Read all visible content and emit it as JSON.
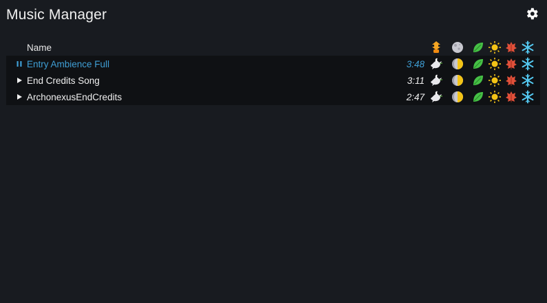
{
  "app": {
    "title": "Music Manager"
  },
  "table": {
    "header": {
      "name_label": "Name"
    },
    "tracks": [
      {
        "name": "Entry Ambience Full",
        "duration": "3:48",
        "state": "playing"
      },
      {
        "name": "End Credits Song",
        "duration": "3:11",
        "state": "stopped"
      },
      {
        "name": "ArchonexusEndCredits",
        "duration": "2:47",
        "state": "stopped"
      }
    ]
  },
  "icons": {
    "settings": "gear-icon",
    "play": "play-icon",
    "pause": "pause-icon",
    "header_condition_1": "danger-fist-icon",
    "header_condition_2": "moon-icon",
    "row_condition_1": "peace-dove-icon",
    "row_condition_2": "day-night-icon",
    "season_spring": "spring-leaf-icon",
    "season_summer": "summer-sun-icon",
    "season_fall": "fall-leaf-icon",
    "season_winter": "winter-snowflake-icon"
  },
  "colors": {
    "background": "#181b20",
    "row_background": "#0f1114",
    "accent_playing": "#3f9fd6",
    "spring": "#46c046",
    "summer": "#f3c316",
    "fall": "#e0503a",
    "winter": "#54c8f0"
  }
}
